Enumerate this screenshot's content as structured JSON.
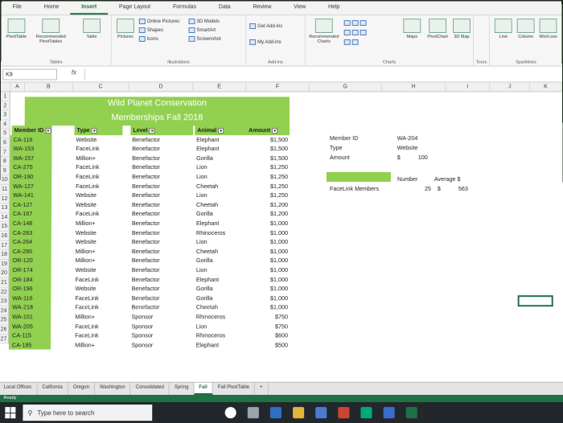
{
  "menu": {
    "tabs": [
      "File",
      "Home",
      "Insert",
      "Page Layout",
      "Formulas",
      "Data",
      "Review",
      "View",
      "Help"
    ],
    "active": "Insert"
  },
  "ribbon": {
    "pivottable": "PivotTable",
    "recommended_pivot": "Recommended PivotTables",
    "table": "Table",
    "tables_label": "Tables",
    "pictures": "Pictures",
    "online_pictures": "Online Pictures",
    "shapes": "Shapes",
    "icons": "Icons",
    "models_3d": "3D Models",
    "smartart": "SmartArt",
    "screenshot": "Screenshot",
    "illustrations_label": "Illustrations",
    "get_addins": "Get Add-ins",
    "my_addins": "My Add-ins",
    "addins_label": "Add-ins",
    "recommended_charts": "Recommended Charts",
    "charts_label": "Charts",
    "maps": "Maps",
    "pivotchart": "PivotChart",
    "map_3d": "3D Map",
    "tours_label": "Tours",
    "line": "Line",
    "column": "Column",
    "winloss": "Win/Loss",
    "sparklines_label": "Sparklines"
  },
  "formula_bar": {
    "name_box": "K9",
    "fx": "fx",
    "content": ""
  },
  "columns": [
    "A",
    "B",
    "C",
    "D",
    "E",
    "F",
    "G",
    "H",
    "I",
    "J",
    "K"
  ],
  "title1": "Wild Planet Conservation",
  "title2": "Memberships Fall 2018",
  "headers": [
    "Member ID",
    "Type",
    "Level",
    "Animal",
    "Amount"
  ],
  "rows": [
    [
      "CA-116",
      "Website",
      "Benefactor",
      "Elephant",
      "$1,500"
    ],
    [
      "WA-153",
      "FaceLink",
      "Benefactor",
      "Elephant",
      "$1,500"
    ],
    [
      "WA-157",
      "Million+",
      "Benefactor",
      "Gorilla",
      "$1,500"
    ],
    [
      "CA-275",
      "FaceLink",
      "Benefactor",
      "Lion",
      "$1,250"
    ],
    [
      "OR-190",
      "FaceLink",
      "Benefactor",
      "Lion",
      "$1,250"
    ],
    [
      "WA-127",
      "FaceLink",
      "Benefactor",
      "Cheetah",
      "$1,250"
    ],
    [
      "WA-141",
      "Website",
      "Benefactor",
      "Lion",
      "$1,250"
    ],
    [
      "CA-127",
      "Website",
      "Benefactor",
      "Cheetah",
      "$1,200"
    ],
    [
      "CA-167",
      "FaceLink",
      "Benefactor",
      "Gorilla",
      "$1,200"
    ],
    [
      "CA-148",
      "Million+",
      "Benefactor",
      "Elephant",
      "$1,000"
    ],
    [
      "CA-263",
      "Website",
      "Benefactor",
      "Rhinoceros",
      "$1,000"
    ],
    [
      "CA-264",
      "Website",
      "Benefactor",
      "Lion",
      "$1,000"
    ],
    [
      "CA-290",
      "Million+",
      "Benefactor",
      "Cheetah",
      "$1,000"
    ],
    [
      "OR-120",
      "Million+",
      "Benefactor",
      "Gorilla",
      "$1,000"
    ],
    [
      "OR-174",
      "Website",
      "Benefactor",
      "Lion",
      "$1,000"
    ],
    [
      "OR-184",
      "FaceLink",
      "Benefactor",
      "Elephant",
      "$1,000"
    ],
    [
      "OR-196",
      "Website",
      "Benefactor",
      "Gorilla",
      "$1,000"
    ],
    [
      "WA-116",
      "FaceLink",
      "Benefactor",
      "Gorilla",
      "$1,000"
    ],
    [
      "WA-218",
      "FaceLink",
      "Benefactor",
      "Cheetah",
      "$1,000"
    ],
    [
      "WA-101",
      "Million+",
      "Sponsor",
      "Rhinoceros",
      "$750"
    ],
    [
      "WA-205",
      "FaceLink",
      "Sponsor",
      "Lion",
      "$750"
    ],
    [
      "CA-115",
      "FaceLink",
      "Sponsor",
      "Rhinoceros",
      "$600"
    ],
    [
      "CA-185",
      "Million+",
      "Sponsor",
      "Elephant",
      "$500"
    ]
  ],
  "lookup": {
    "member_id_label": "Member ID",
    "member_id_value": "WA-204",
    "type_label": "Type",
    "type_value": "Website",
    "amount_label": "Amount",
    "amount_currency": "$",
    "amount_value": "100"
  },
  "stats": {
    "label": "FaceLink Members",
    "number_header": "Number",
    "average_header": "Average $",
    "number": "25",
    "currency": "$",
    "average": "563"
  },
  "sheet_tabs": [
    "Local Offices",
    "California",
    "Oregon",
    "Washington",
    "Consolidated",
    "Spring",
    "Fall",
    "Fall PivotTable"
  ],
  "active_sheet": "Fall",
  "status": "Ready",
  "taskbar": {
    "search": "Type here to search"
  }
}
